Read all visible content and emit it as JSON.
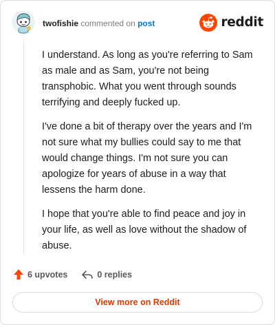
{
  "header": {
    "username": "twofishie",
    "action_text": "commented on",
    "post_link_label": "post"
  },
  "brand": {
    "wordmark": "reddit",
    "logo_icon": "reddit-snoo-icon",
    "color": "#ff4500"
  },
  "comment": {
    "paragraphs": [
      "I understand. As long as you're referring to Sam as male and as Sam, you're not being transphobic. What you went through sounds terrifying and deeply fucked up.",
      "I've done a bit of therapy over the years and I'm not sure what my bullies could say to me that would change things. I'm not sure you can apologize for years of abuse in a way that lessens the harm done.",
      "I hope that you're able to find peace and joy in your life, as well as love without the shadow of abuse."
    ]
  },
  "actions": {
    "upvotes_label": "6 upvotes",
    "upvote_icon": "upvote-arrow-icon",
    "replies_label": "0 replies",
    "reply_icon": "reply-arrow-icon"
  },
  "footer": {
    "view_more_label": "View more on Reddit"
  },
  "colors": {
    "upvote": "#ff4500",
    "link": "#0079d3",
    "view_more": "#d93a00"
  }
}
